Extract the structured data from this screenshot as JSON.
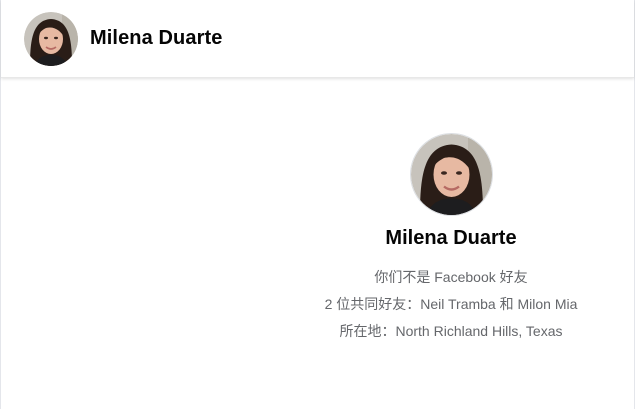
{
  "header": {
    "name": "Milena Duarte",
    "avatar_icon": "profile-photo"
  },
  "profile": {
    "name": "Milena Duarte",
    "avatar_icon": "profile-photo",
    "friend_status": "你们不是 Facebook 好友",
    "mutual_friends": "2 位共同好友：Neil Tramba 和 Milon Mia",
    "location": "所在地：North Richland Hills, Texas"
  },
  "colors": {
    "name_text": "#050505",
    "secondary_text": "#65676b",
    "background": "#ffffff"
  }
}
